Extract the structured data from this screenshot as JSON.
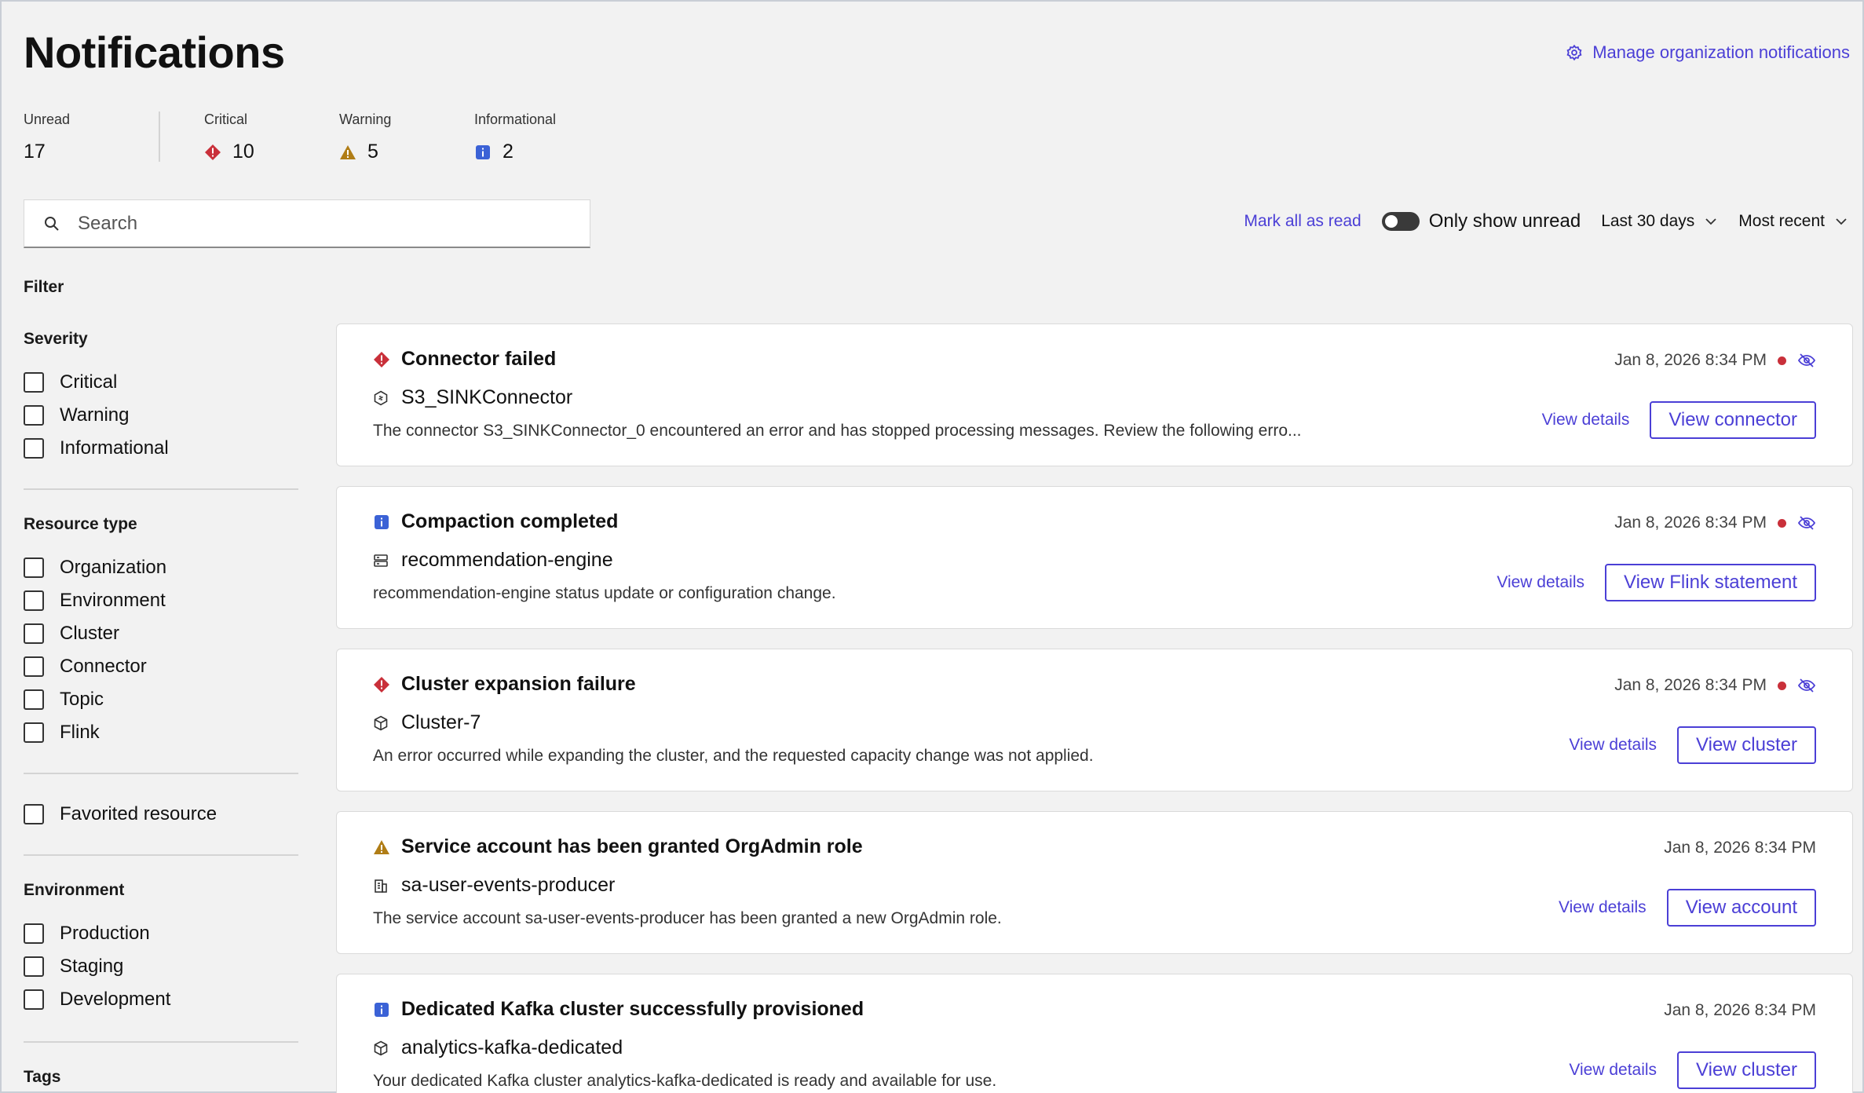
{
  "header": {
    "title": "Notifications",
    "manage_link": "Manage organization notifications"
  },
  "summary": {
    "unread": {
      "label": "Unread",
      "value": "17"
    },
    "critical": {
      "label": "Critical",
      "value": "10"
    },
    "warning": {
      "label": "Warning",
      "value": "5"
    },
    "informational": {
      "label": "Informational",
      "value": "2"
    }
  },
  "search": {
    "placeholder": "Search",
    "value": ""
  },
  "toolbar": {
    "mark_all": "Mark all as read",
    "only_unread": "Only show unread",
    "only_unread_on": false,
    "range": "Last 30 days",
    "sort": "Most recent"
  },
  "filter": {
    "title": "Filter",
    "severity": {
      "title": "Severity",
      "items": [
        "Critical",
        "Warning",
        "Informational"
      ]
    },
    "resource_type": {
      "title": "Resource type",
      "items": [
        "Organization",
        "Environment",
        "Cluster",
        "Connector",
        "Topic",
        "Flink"
      ]
    },
    "favorited": "Favorited resource",
    "environment": {
      "title": "Environment",
      "items": [
        "Production",
        "Staging",
        "Development"
      ]
    },
    "tags": {
      "title": "Tags"
    }
  },
  "colors": {
    "accent": "#4b3fd6",
    "critical": "#c9303a",
    "warning": "#b07d16",
    "informational": "#3b62d6"
  },
  "notifications": [
    {
      "severity": "critical",
      "title": "Connector failed",
      "resource_icon": "connector-icon",
      "resource": "S3_SINKConnector",
      "description": "The connector S3_SINKConnector_0 encountered an error and has stopped processing messages. Review the following erro...",
      "timestamp": "Jan 8, 2026 8:34 PM",
      "unread": true,
      "details": "View details",
      "action": "View connector"
    },
    {
      "severity": "informational",
      "title": "Compaction completed",
      "resource_icon": "flink-statement-icon",
      "resource": "recommendation-engine",
      "description": "recommendation-engine status update or configuration change.",
      "timestamp": "Jan 8, 2026 8:34 PM",
      "unread": true,
      "details": "View details",
      "action": "View Flink statement"
    },
    {
      "severity": "critical",
      "title": "Cluster expansion failure",
      "resource_icon": "cluster-icon",
      "resource": "Cluster-7",
      "description": "An error occurred while expanding the cluster, and the requested capacity change was not applied.",
      "timestamp": "Jan 8, 2026 8:34 PM",
      "unread": true,
      "details": "View details",
      "action": "View cluster"
    },
    {
      "severity": "warning",
      "title": "Service account has been granted OrgAdmin role",
      "resource_icon": "organization-icon",
      "resource": "sa-user-events-producer",
      "description": "The service account sa-user-events-producer has been granted a new OrgAdmin role.",
      "timestamp": "Jan 8, 2026 8:34 PM",
      "unread": false,
      "details": "View details",
      "action": "View account"
    },
    {
      "severity": "informational",
      "title": "Dedicated Kafka cluster successfully provisioned",
      "resource_icon": "cluster-icon",
      "resource": "analytics-kafka-dedicated",
      "description": "Your dedicated Kafka cluster analytics-kafka-dedicated  is ready and available for use.",
      "timestamp": "Jan 8, 2026 8:34 PM",
      "unread": false,
      "details": "View details",
      "action": "View cluster"
    }
  ]
}
